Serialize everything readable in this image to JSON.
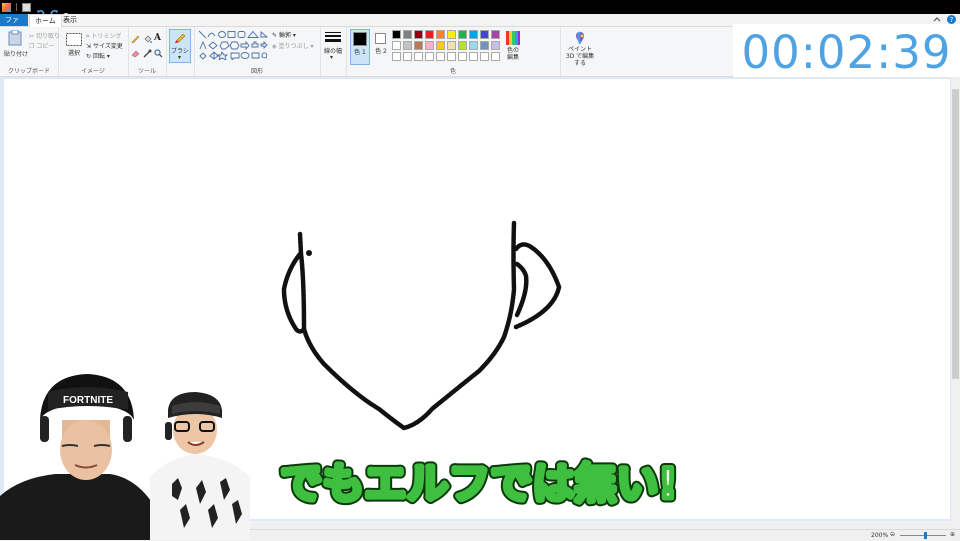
{
  "tabs": {
    "file": "ファイル",
    "home": "ホーム",
    "view": "表示"
  },
  "clipboard": {
    "paste": "貼り付け",
    "cut": "切り取り",
    "copy": "コピー",
    "label": "クリップボード"
  },
  "image": {
    "select": "選択",
    "trim": "トリミング",
    "resize": "サイズ変更",
    "rotate": "回転",
    "label": "イメージ"
  },
  "tools": {
    "label": "ツール"
  },
  "brushes": {
    "label": "ブラシ"
  },
  "shapes": {
    "outline": "輪郭",
    "fill": "塗りつぶし",
    "label": "図形"
  },
  "size": {
    "label": "線の幅"
  },
  "colors": {
    "color1": "色 1",
    "color2": "色 2",
    "edit": "色の編集",
    "label": "色",
    "palette": [
      "#000000",
      "#7f7f7f",
      "#880015",
      "#ed1c24",
      "#ff7f27",
      "#fff200",
      "#22b14c",
      "#00a2e8",
      "#3f48cc",
      "#a349a4",
      "#ffffff",
      "#c3c3c3",
      "#b97a57",
      "#ffaec9",
      "#ffc90e",
      "#efe4b0",
      "#b5e61d",
      "#99d9ea",
      "#7092be",
      "#c8bfe7",
      "#ffffff",
      "#ffffff",
      "#ffffff",
      "#ffffff",
      "#ffffff",
      "#ffffff",
      "#ffffff",
      "#ffffff",
      "#ffffff",
      "#ffffff"
    ]
  },
  "paint3d": {
    "label": "ペイント 3D で編集する"
  },
  "timer": "00:02:39",
  "caption": "でもエルフでは無い!",
  "status": {
    "zoom": "200%"
  }
}
